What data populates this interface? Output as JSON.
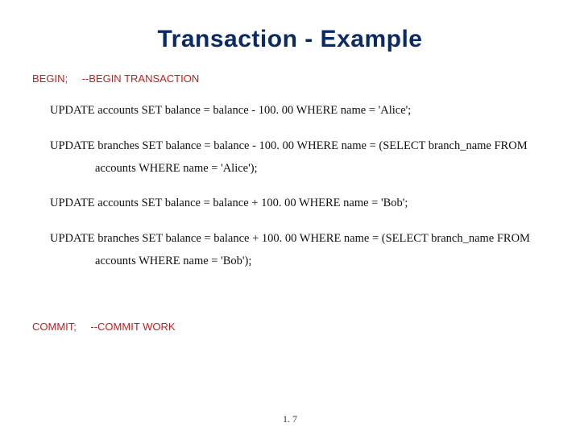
{
  "title": "Transaction - Example",
  "begin": {
    "keyword": "BEGIN;",
    "comment": "--BEGIN TRANSACTION"
  },
  "sql": {
    "s1": "UPDATE accounts SET balance = balance - 100. 00 WHERE name = 'Alice';",
    "s2a": "UPDATE branches SET balance = balance - 100. 00 WHERE name = (SELECT branch_name FROM",
    "s2b": "accounts WHERE name = 'Alice');",
    "s3": "UPDATE accounts SET balance = balance + 100. 00 WHERE name = 'Bob';",
    "s4a": "UPDATE branches SET balance = balance + 100. 00 WHERE name = (SELECT branch_name FROM",
    "s4b": "accounts WHERE name = 'Bob');"
  },
  "commit": {
    "keyword": "COMMIT;",
    "comment": "--COMMIT WORK"
  },
  "page_number": "1. 7"
}
